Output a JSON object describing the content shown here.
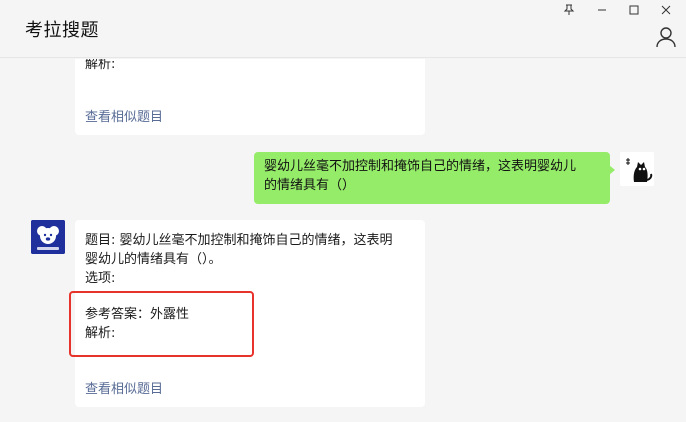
{
  "app": {
    "title": "考拉搜题"
  },
  "window_controls": [
    {
      "name": "pin",
      "icon": "pin-icon"
    },
    {
      "name": "minimize",
      "icon": "minimize-icon"
    },
    {
      "name": "maximize",
      "icon": "maximize-icon"
    },
    {
      "name": "close",
      "icon": "close-icon"
    }
  ],
  "user_menu": {
    "icon": "user-icon"
  },
  "messages": {
    "prev_answer": {
      "analysis_label": "解析:",
      "similar_link": "查看相似题目"
    },
    "user_question": {
      "line1": "婴幼儿丝毫不加控制和掩饰自己的情绪，这表明婴幼儿",
      "line2": "的情绪具有（）"
    },
    "bot_answer": {
      "question_line1": "题目: 婴幼儿丝毫不加控制和掩饰自己的情绪，这表明",
      "question_line2": "婴幼儿的情绪具有（）。",
      "options_label": "选项:",
      "answer_text": "参考答案：外露性",
      "analysis_label": "解析:",
      "similar_link": "查看相似题目"
    }
  },
  "colors": {
    "green_bubble": "#95ec69",
    "link": "#576b95",
    "highlight": "#e8332c",
    "bot_avatar_bg": "#1f2f9c"
  }
}
